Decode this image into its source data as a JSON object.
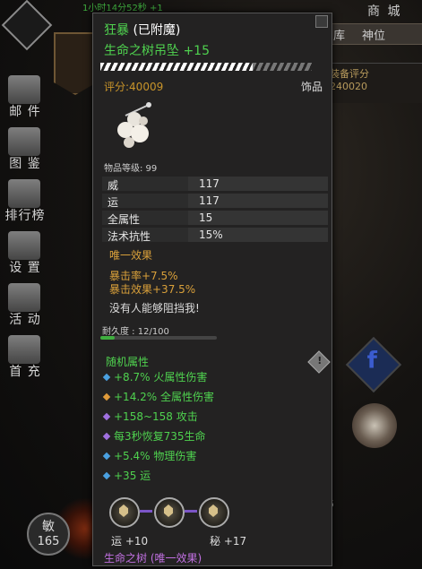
{
  "timer": "1小时14分52秒 +1",
  "shop": "商 城",
  "sidebar": [
    {
      "label": "邮 件",
      "icon": "mail-icon"
    },
    {
      "label": "图 鉴",
      "icon": "book-icon"
    },
    {
      "label": "排行榜",
      "icon": "ranking-icon"
    },
    {
      "label": "设 置",
      "icon": "gear-icon"
    },
    {
      "label": "活 动",
      "icon": "event-icon"
    },
    {
      "label": "首 充",
      "icon": "first-recharge-icon"
    }
  ],
  "right_tabs": [
    "库",
    "神位"
  ],
  "equip_score": {
    "label": "装备评分",
    "value": "240020"
  },
  "stat_circle": {
    "label": "敏",
    "value": "165"
  },
  "right_number": "5",
  "item": {
    "name": "狂暴",
    "name_suffix": "(已附魔)",
    "title": "生命之树吊坠 +15",
    "score": "评分:40009",
    "slot": "饰品",
    "level": "物品等级: 99",
    "attributes": [
      {
        "key": "威",
        "value": "117"
      },
      {
        "key": "运",
        "value": "117"
      },
      {
        "key": "全属性",
        "value": "15"
      },
      {
        "key": "法术抗性",
        "value": "15%"
      }
    ],
    "unique_header": "唯一效果",
    "unique": [
      "暴击率+7.5%",
      "暴击效果+37.5%"
    ],
    "quote": "没有人能够阻挡我!",
    "durability": "耐久度 : 12/100",
    "durability_fraction": 0.12,
    "random_header": "随机属性",
    "random": [
      {
        "text": "+8.7% 火属性伤害",
        "color": "#4aa0e0"
      },
      {
        "text": "+14.2% 全属性伤害",
        "color": "#e09a3a"
      },
      {
        "text": "+158~158 攻击",
        "color": "#a070e0"
      },
      {
        "text": "每3秒恢复735生命",
        "color": "#a070e0"
      },
      {
        "text": "+5.4% 物理伤害",
        "color": "#4aa0e0"
      },
      {
        "text": "+35 运",
        "color": "#4aa0e0"
      }
    ],
    "gem_labels": [
      "运 +10",
      "秘 +17"
    ],
    "set": "生命之树 (唯一效果)"
  }
}
